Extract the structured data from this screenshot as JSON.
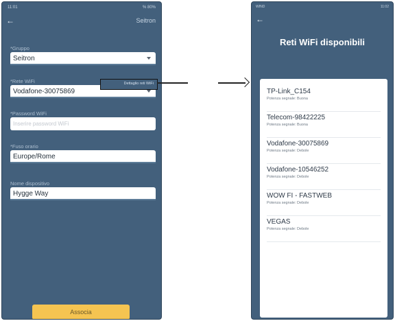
{
  "phone1": {
    "status": {
      "time": "11:01",
      "right": "% 80%"
    },
    "header": {
      "back_icon": "back-arrow-icon",
      "title": "Seitron"
    },
    "fields": {
      "gruppo": {
        "label": "*Gruppo",
        "value": "Seitron"
      },
      "rete_wifi": {
        "label": "*Rete WiFi",
        "value": "Vodafone-30075869",
        "detail_link": "Dettaglio reti WiFi"
      },
      "password": {
        "label": "*Password WiFi",
        "placeholder": "Inserire password WiFi"
      },
      "fuso": {
        "label": "*Fuso orario",
        "value": "Europe/Rome"
      },
      "nome": {
        "label": "Nome dispositivo",
        "value": "Hygge Way"
      }
    },
    "button": {
      "label": "Associa"
    }
  },
  "phone2": {
    "status": {
      "left": "WIND",
      "right": "11:02"
    },
    "header": {
      "back_icon": "back-arrow-icon"
    },
    "title": "Reti WiFi disponibili",
    "networks": [
      {
        "name": "TP-Link_C154",
        "signal": "Potenza segnale: Buona"
      },
      {
        "name": "Telecom-98422225",
        "signal": "Potenza segnale: Buona"
      },
      {
        "name": "Vodafone-30075869",
        "signal": "Potenza segnale: Debole"
      },
      {
        "name": "Vodafone-10546252",
        "signal": "Potenza segnale: Debole"
      },
      {
        "name": "WOW FI - FASTWEB",
        "signal": "Potenza segnale: Debole"
      },
      {
        "name": "VEGAS",
        "signal": "Potenza segnale: Debole"
      }
    ]
  },
  "colors": {
    "background": "#43607c",
    "button": "#f5c451",
    "field": "#ffffff"
  }
}
